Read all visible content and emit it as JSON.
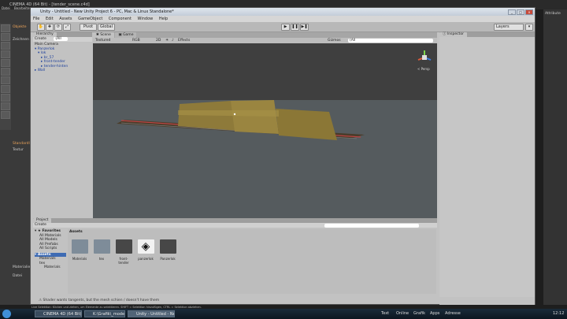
{
  "c4d": {
    "title": "CINEMA 4D (64 Bit) - [tender_scene.c4d]",
    "menu": [
      "Datei",
      "Bearbeiten"
    ],
    "side_labels": [
      "Objekte",
      "Zeichnen"
    ],
    "right_panel_label": "Attribute",
    "left_labels": [
      "Standardlayo",
      "Textur"
    ],
    "bottom_labels": [
      "Materialien",
      "Datei"
    ]
  },
  "unity": {
    "title": "Unity - Untitled - New Unity Project 6 - PC, Mac & Linux Standalone*",
    "menu": [
      "File",
      "Edit",
      "Assets",
      "GameObject",
      "Component",
      "Window",
      "Help"
    ],
    "toolbar": {
      "pivot": "Pivot",
      "global": "Global",
      "layers": "Layers",
      "layout": "Layout"
    },
    "hierarchy": {
      "tab": "Hierarchy",
      "create": "Create",
      "search": "(All",
      "items": [
        {
          "label": "Main Camera",
          "indent": 0
        },
        {
          "label": "Panzerlok",
          "indent": 0
        },
        {
          "label": "lok",
          "indent": 1
        },
        {
          "label": "br_57",
          "indent": 2
        },
        {
          "label": "front-tender",
          "indent": 2
        },
        {
          "label": "tender-hinten",
          "indent": 2
        },
        {
          "label": "Wall",
          "indent": 0
        }
      ]
    },
    "scene": {
      "tab": "Scene",
      "game_tab": "Game",
      "shading": "Textured",
      "rgb": "RGB",
      "twod": "2D",
      "effects": "Effects",
      "gizmos": "Gizmos",
      "search": "(All",
      "persp": "< Persp"
    },
    "inspector": {
      "tab": "Inspector"
    },
    "project": {
      "tab": "Project",
      "create": "Create",
      "favorites_title": "Favorites",
      "favorites": [
        "All Materials",
        "All Models",
        "All Prefabs",
        "All Scripts"
      ],
      "assets_title": "Assets",
      "assets_tree": [
        {
          "label": "Materials",
          "indent": 1
        },
        {
          "label": "tex",
          "indent": 1
        },
        {
          "label": "Materials",
          "indent": 2
        }
      ],
      "breadcrumb": "Assets",
      "items": [
        {
          "label": "Materials",
          "kind": "folder"
        },
        {
          "label": "tex",
          "kind": "folder"
        },
        {
          "label": "front-tender",
          "kind": "model"
        },
        {
          "label": "panzerlok",
          "kind": "unity"
        },
        {
          "label": "Panzerlok",
          "kind": "model"
        }
      ]
    },
    "status": "Shader wants tangents, but the mesh schien / doesn't have them",
    "c4d_status": "Live Selektion: Klicken und ziehen, um Elemente zu selektieren. SHIFT = Selektion hinzufügen, CTRL = Selektion abziehen."
  },
  "taskbar": {
    "items": [
      "CINEMA 4D (64 Bit) - ...",
      "K:\\Grafik\\_modelling\\...",
      "Unity - Untitled - Ne..."
    ],
    "tray": [
      "Text",
      "Online",
      "Grafik",
      "Apps",
      "Adresse"
    ],
    "time": "12:12"
  }
}
